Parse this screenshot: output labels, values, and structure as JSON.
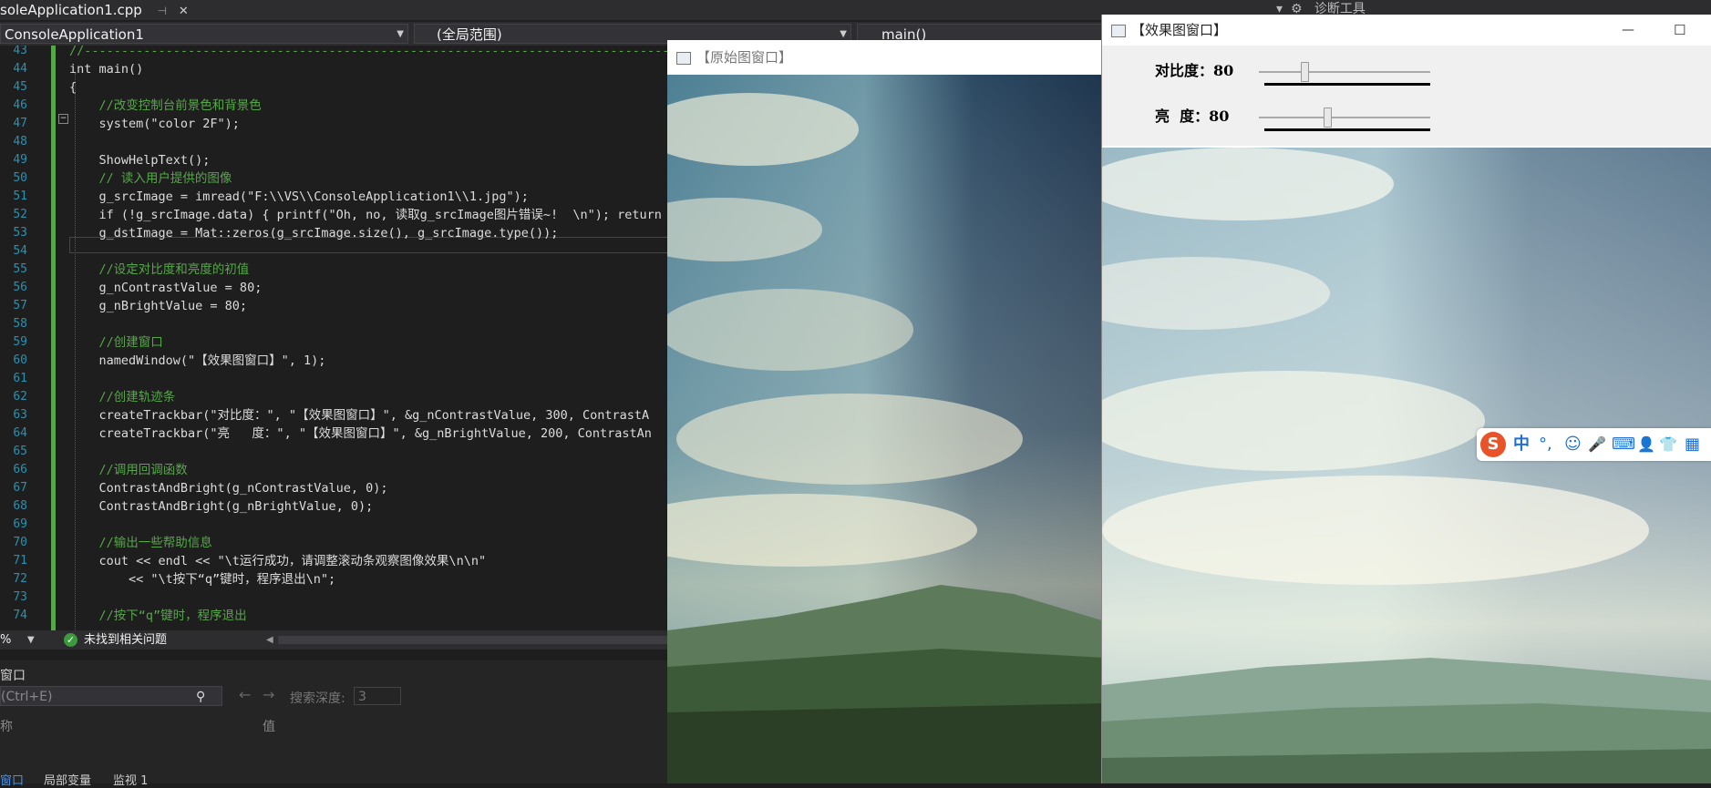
{
  "ide": {
    "file_tab": "soleApplication1.cpp",
    "tab_right_label": "诊断工具",
    "nav_project": "ConsoleApplication1",
    "nav_scope": "(全局范围)",
    "nav_function": "main()",
    "status_zoom": "%",
    "status_issues": "未找到相关问题",
    "panel_title": "窗口",
    "panel_search_placeholder": "(Ctrl+E)",
    "panel_search_depth_label": "搜索深度:",
    "panel_search_depth_value": "3",
    "panel_col_name": "称",
    "panel_col_value": "值",
    "panel_tabs": [
      "窗口",
      "局部变量",
      "监视 1"
    ],
    "code_lines": [
      {
        "n": "43",
        "t": "//-----------------------------------------------------------------------------------------",
        "c": "cm"
      },
      {
        "n": "44",
        "t": "int main()",
        "c": ""
      },
      {
        "n": "45",
        "t": "{",
        "c": ""
      },
      {
        "n": "46",
        "t": "    //改变控制台前景色和背景色",
        "c": "cm"
      },
      {
        "n": "47",
        "t": "    system(\"color 2F\");",
        "c": ""
      },
      {
        "n": "48",
        "t": "",
        "c": ""
      },
      {
        "n": "49",
        "t": "    ShowHelpText();",
        "c": ""
      },
      {
        "n": "50",
        "t": "    // 读入用户提供的图像",
        "c": "cm"
      },
      {
        "n": "51",
        "t": "    g_srcImage = imread(\"F:\\\\VS\\\\ConsoleApplication1\\\\1.jpg\");",
        "c": ""
      },
      {
        "n": "52",
        "t": "    if (!g_srcImage.data) { printf(\"Oh, no, 读取g_srcImage图片错误~!  \\n\"); return",
        "c": ""
      },
      {
        "n": "53",
        "t": "    g_dstImage = Mat::zeros(g_srcImage.size(), g_srcImage.type());",
        "c": ""
      },
      {
        "n": "54",
        "t": "",
        "c": ""
      },
      {
        "n": "55",
        "t": "    //设定对比度和亮度的初值",
        "c": "cm"
      },
      {
        "n": "56",
        "t": "    g_nContrastValue = 80;",
        "c": ""
      },
      {
        "n": "57",
        "t": "    g_nBrightValue = 80;",
        "c": ""
      },
      {
        "n": "58",
        "t": "",
        "c": ""
      },
      {
        "n": "59",
        "t": "    //创建窗口",
        "c": "cm"
      },
      {
        "n": "60",
        "t": "    namedWindow(\"【效果图窗口】\", 1);",
        "c": ""
      },
      {
        "n": "61",
        "t": "",
        "c": ""
      },
      {
        "n": "62",
        "t": "    //创建轨迹条",
        "c": "cm"
      },
      {
        "n": "63",
        "t": "    createTrackbar(\"对比度：\", \"【效果图窗口】\", &g_nContrastValue, 300, ContrastA",
        "c": ""
      },
      {
        "n": "64",
        "t": "    createTrackbar(\"亮   度：\", \"【效果图窗口】\", &g_nBrightValue, 200, ContrastAn",
        "c": ""
      },
      {
        "n": "65",
        "t": "",
        "c": ""
      },
      {
        "n": "66",
        "t": "    //调用回调函数",
        "c": "cm"
      },
      {
        "n": "67",
        "t": "    ContrastAndBright(g_nContrastValue, 0);",
        "c": ""
      },
      {
        "n": "68",
        "t": "    ContrastAndBright(g_nBrightValue, 0);",
        "c": ""
      },
      {
        "n": "69",
        "t": "",
        "c": ""
      },
      {
        "n": "70",
        "t": "    //输出一些帮助信息",
        "c": "cm"
      },
      {
        "n": "71",
        "t": "    cout << endl << \"\\t运行成功，请调整滚动条观察图像效果\\n\\n\"",
        "c": ""
      },
      {
        "n": "72",
        "t": "        << \"\\t按下“q”键时，程序退出\\n\";",
        "c": ""
      },
      {
        "n": "73",
        "t": "",
        "c": ""
      },
      {
        "n": "74",
        "t": "    //按下“q”键时，程序退出",
        "c": "cm"
      }
    ]
  },
  "source_window": {
    "title": "【原始图窗口】"
  },
  "effect_window": {
    "title": "【效果图窗口】",
    "minimize_glyph": "—",
    "maximize_glyph": "☐",
    "trackbars": [
      {
        "label": "对比度：80",
        "value": 80,
        "max": 300
      },
      {
        "label": "亮  度：80",
        "value": 80,
        "max": 200
      }
    ]
  },
  "ime_toolbar": {
    "items": [
      "S",
      "中",
      "°,",
      "☺",
      "🎤",
      "⌨",
      "👤",
      "👕",
      "▦"
    ]
  }
}
